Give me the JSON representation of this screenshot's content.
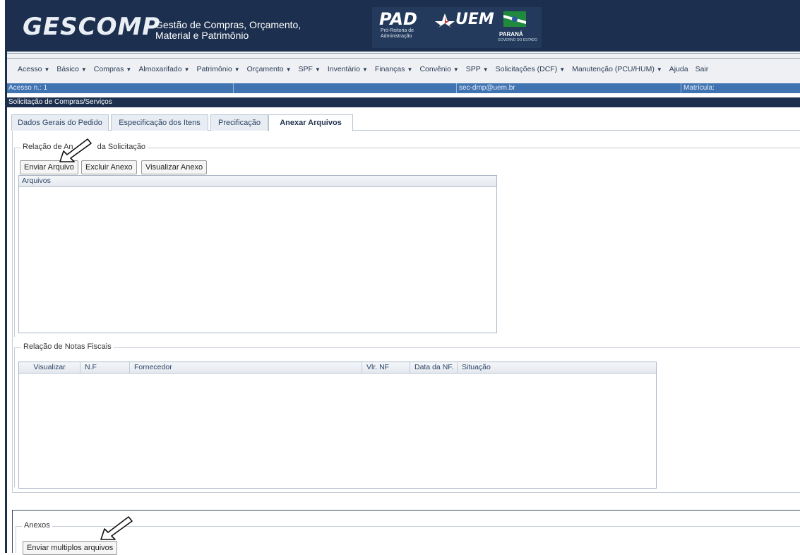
{
  "header": {
    "brand": "GESCOMP",
    "tagline": "Gestão de Compras, Orçamento, Material e Patrimônio",
    "pad_logo": "PAD",
    "pad_sub": "Pró-Reitoria de Administração",
    "uem_logo": "UEM",
    "parana_logo": "PARANÁ",
    "parana_sub": "GOVERNO DO ESTADO"
  },
  "menu": [
    {
      "label": "Acesso",
      "caret": "▼"
    },
    {
      "label": "Básico",
      "caret": "▼"
    },
    {
      "label": "Compras",
      "caret": "▼"
    },
    {
      "label": "Almoxarifado",
      "caret": "▼"
    },
    {
      "label": "Patrimônio",
      "caret": "▼"
    },
    {
      "label": "Orçamento",
      "caret": "▼"
    },
    {
      "label": "SPF",
      "caret": "▼"
    },
    {
      "label": "Inventário",
      "caret": "▼"
    },
    {
      "label": "Finanças",
      "caret": "▼"
    },
    {
      "label": "Convênio",
      "caret": "▼"
    },
    {
      "label": "SPP",
      "caret": "▼"
    },
    {
      "label": "Solicitações (DCF)",
      "caret": "▼"
    },
    {
      "label": "Manutenção (PCU/HUM)",
      "caret": "▼"
    },
    {
      "label": "Ajuda",
      "caret": ""
    },
    {
      "label": "Sair",
      "caret": ""
    }
  ],
  "status": {
    "acesso": "Acesso n.: 1",
    "email": "sec-dmp@uem.br",
    "matricula": "Matrícula:"
  },
  "form_title": "Solicitação de Compras/Serviços",
  "tabs": [
    {
      "label": "Dados Gerais do Pedido",
      "active": false
    },
    {
      "label": "Especificação dos Itens",
      "active": false
    },
    {
      "label": "Precificação",
      "active": false
    },
    {
      "label": "Anexar Arquivos",
      "active": true
    }
  ],
  "anexos_section": {
    "legend_start": "Relação de An",
    "legend_end": "da Solicitação",
    "buttons": {
      "enviar": "Enviar Arquivo",
      "excluir": "Excluir Anexo",
      "visualizar": "Visualizar Anexo"
    },
    "grid_header": "Arquivos"
  },
  "notas_section": {
    "legend": "Relação de Notas Fiscais",
    "columns": [
      "Visualizar",
      "N.F",
      "Fornecedor",
      "Vlr. NF",
      "Data da NF.",
      "Situação"
    ]
  },
  "anexos_bottom": {
    "legend": "Anexos",
    "button": "Enviar multiplos arquivos"
  },
  "icons": {
    "arrow_pointer": "arrow-pointer-icon",
    "caret": "caret-down-icon"
  },
  "colors": {
    "header_bg": "#1c2f4e",
    "status_bar": "#3f73b1",
    "tab_border": "#b8c4d2"
  }
}
